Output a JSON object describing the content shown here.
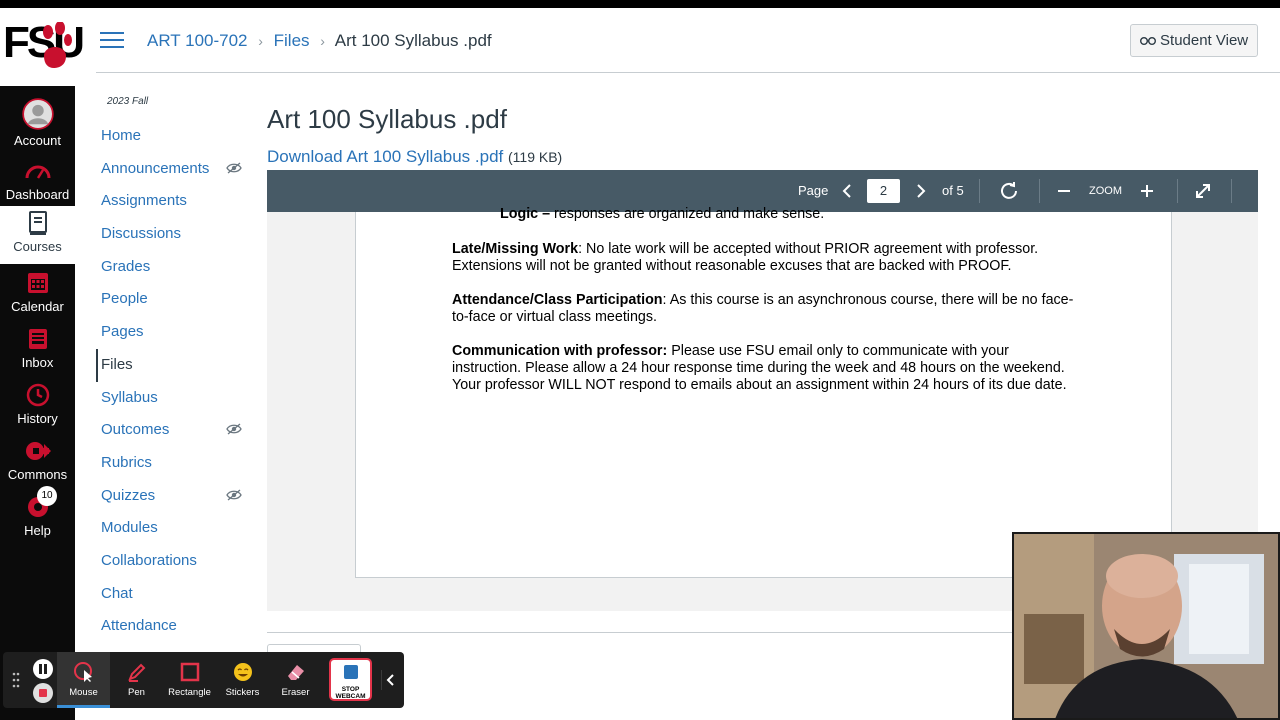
{
  "global_nav": {
    "items": [
      {
        "label": "Account",
        "icon": "account-avatar-icon"
      },
      {
        "label": "Dashboard",
        "icon": "dashboard-icon"
      },
      {
        "label": "Courses",
        "icon": "courses-icon",
        "active": true
      },
      {
        "label": "Calendar",
        "icon": "calendar-icon"
      },
      {
        "label": "Inbox",
        "icon": "inbox-icon"
      },
      {
        "label": "History",
        "icon": "history-icon"
      },
      {
        "label": "Commons",
        "icon": "commons-icon"
      },
      {
        "label": "Help",
        "icon": "help-icon",
        "badge": "10"
      }
    ],
    "logo_text": "FSU",
    "accent": "#c8102e"
  },
  "header": {
    "breadcrumb": {
      "course": "ART 100-702",
      "section": "Files",
      "current": "Art 100 Syllabus .pdf"
    },
    "student_view_label": "Student View"
  },
  "course_nav": {
    "term": "2023 Fall",
    "items": [
      {
        "label": "Home"
      },
      {
        "label": "Announcements",
        "hidden_icon": true
      },
      {
        "label": "Assignments"
      },
      {
        "label": "Discussions"
      },
      {
        "label": "Grades"
      },
      {
        "label": "People"
      },
      {
        "label": "Pages"
      },
      {
        "label": "Files",
        "active": true
      },
      {
        "label": "Syllabus"
      },
      {
        "label": "Outcomes",
        "hidden_icon": true
      },
      {
        "label": "Rubrics"
      },
      {
        "label": "Quizzes",
        "hidden_icon": true
      },
      {
        "label": "Modules"
      },
      {
        "label": "Collaborations"
      },
      {
        "label": "Chat"
      },
      {
        "label": "Attendance"
      }
    ]
  },
  "main": {
    "title": "Art 100 Syllabus .pdf",
    "download_label": "Download Art 100 Syllabus .pdf",
    "file_size": "(119 KB)"
  },
  "viewer": {
    "page_label": "Page",
    "current_page": "2",
    "of_pages": "of 5",
    "zoom_label": "ZOOM",
    "content": {
      "logic_bold": "Logic –",
      "logic_text": " responses are organized and make sense.",
      "late_bold": "Late/Missing Work",
      "late_text": ":  No late work will be accepted without PRIOR agreement with professor. Extensions will not be granted without reasonable excuses that are backed with PROOF.",
      "attend_bold": "Attendance/Class Participation",
      "attend_text": ": As this course is an asynchronous course, there will be no face-to-face or virtual class meetings.",
      "comm_bold": "Communication with professor:",
      "comm_text": " Please use FSU email only to communicate with your instruction. Please allow a 24 hour response time during the week and 48 hours on the weekend. Your professor WILL NOT respond to emails about an assignment within 24 hours of its due date."
    }
  },
  "recorder": {
    "tools": [
      {
        "label": "Mouse",
        "icon": "mouse-pointer-icon",
        "active": true
      },
      {
        "label": "Pen",
        "icon": "pen-icon"
      },
      {
        "label": "Rectangle",
        "icon": "rectangle-icon"
      },
      {
        "label": "Stickers",
        "icon": "sticker-icon"
      },
      {
        "label": "Eraser",
        "icon": "eraser-icon"
      }
    ],
    "webcam_label_1": "STOP",
    "webcam_label_2": "WEBCAM"
  }
}
